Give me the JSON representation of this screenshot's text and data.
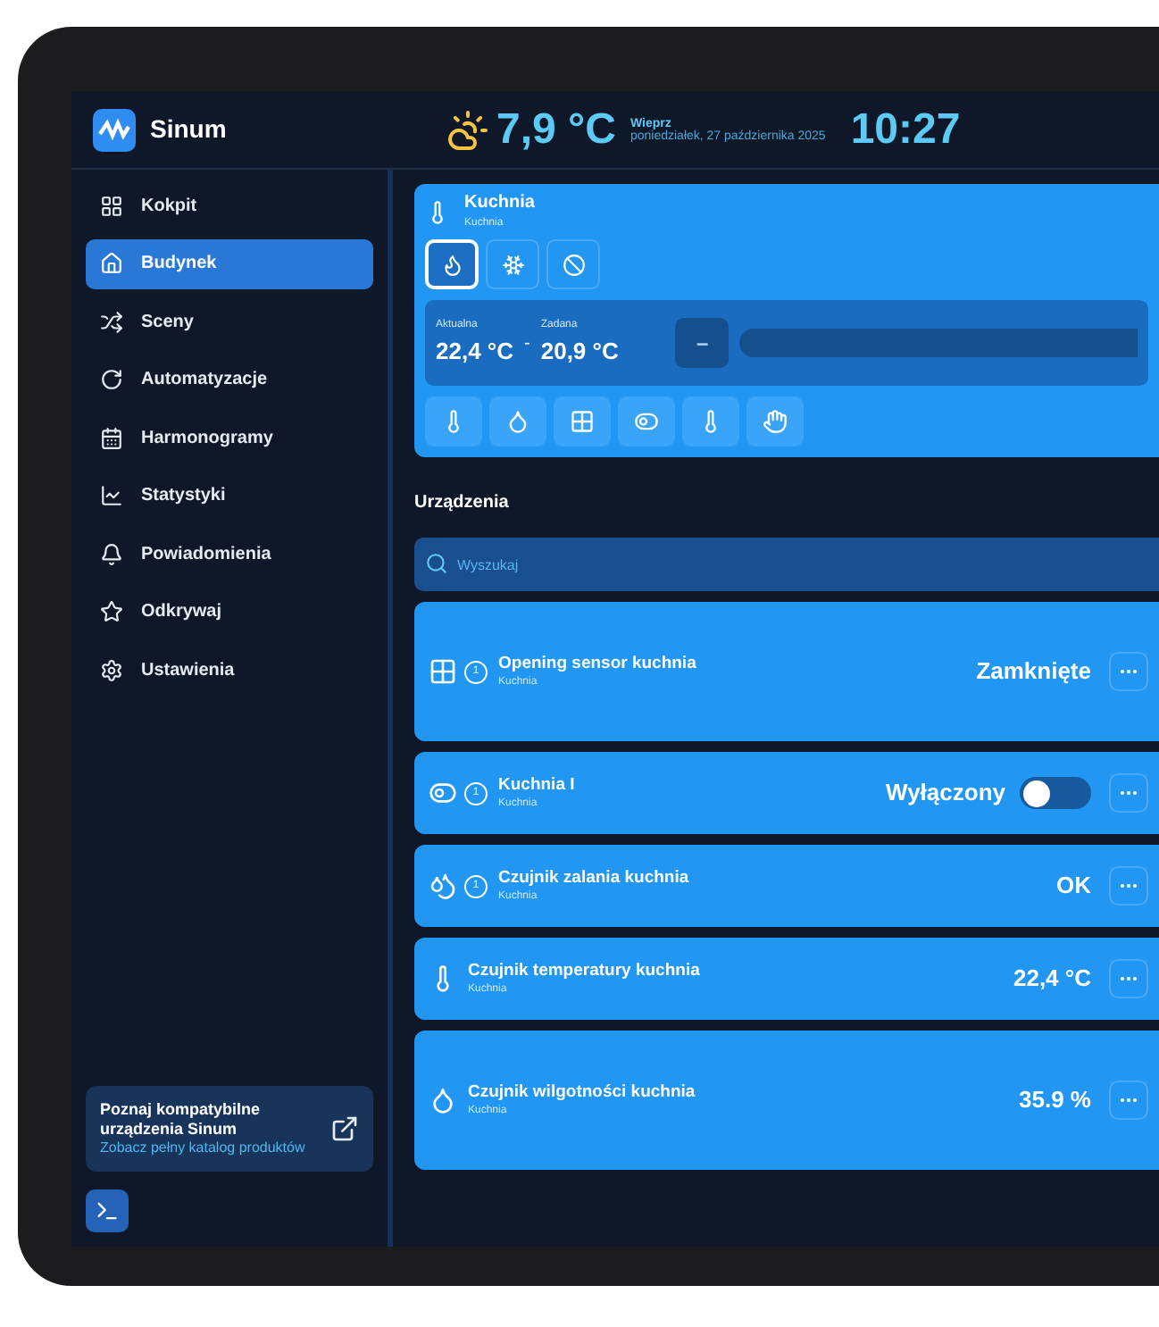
{
  "app": {
    "name": "Sinum"
  },
  "header": {
    "temperature": "7,9 °C",
    "location": "Wieprz",
    "date": "poniedziałek, 27 października 2025",
    "time": "10:27"
  },
  "sidebar": {
    "items": [
      {
        "label": "Kokpit",
        "selected": false
      },
      {
        "label": "Budynek",
        "selected": true
      },
      {
        "label": "Sceny",
        "selected": false
      },
      {
        "label": "Automatyzacje",
        "selected": false
      },
      {
        "label": "Harmonogramy",
        "selected": false
      },
      {
        "label": "Statystyki",
        "selected": false
      },
      {
        "label": "Powiadomienia",
        "selected": false
      },
      {
        "label": "Odkrywaj",
        "selected": false
      },
      {
        "label": "Ustawienia",
        "selected": false
      }
    ],
    "promo": {
      "title": "Poznaj kompatybilne urządzenia Sinum",
      "link": "Zobacz pełny katalog produktów"
    }
  },
  "room": {
    "title": "Kuchnia",
    "subtitle": "Kuchnia",
    "modes": [
      {
        "kind": "heat",
        "selected": true
      },
      {
        "kind": "cool",
        "selected": false
      },
      {
        "kind": "off",
        "selected": false
      }
    ],
    "current_label": "Aktualna",
    "current": "22,4 °C",
    "separator": "-",
    "target_label": "Zadana",
    "target": "20,9 °C",
    "decrease": "–",
    "filters": [
      {
        "kind": "thermostat"
      },
      {
        "kind": "humidity"
      },
      {
        "kind": "opening"
      },
      {
        "kind": "switch"
      },
      {
        "kind": "temperature"
      },
      {
        "kind": "hand"
      }
    ]
  },
  "devices": {
    "title": "Urządzenia",
    "search": {
      "placeholder": "Wyszukaj"
    },
    "items": [
      {
        "kind": "opening",
        "badge": "1",
        "name": "Opening sensor kuchnia",
        "room": "Kuchnia",
        "value": "Zamknięte"
      },
      {
        "kind": "switch",
        "badge": "1",
        "name": "Kuchnia I",
        "room": "Kuchnia",
        "value": "Wyłączony",
        "on": false
      },
      {
        "kind": "flood",
        "badge": "1",
        "name": "Czujnik zalania kuchnia",
        "room": "Kuchnia",
        "value": "OK"
      },
      {
        "kind": "temperature",
        "name": "Czujnik temperatury kuchnia",
        "room": "Kuchnia",
        "value": "22,4 °C"
      },
      {
        "kind": "humidity",
        "name": "Czujnik wilgotności kuchnia",
        "room": "Kuchnia",
        "value": "35.9 %"
      }
    ]
  }
}
